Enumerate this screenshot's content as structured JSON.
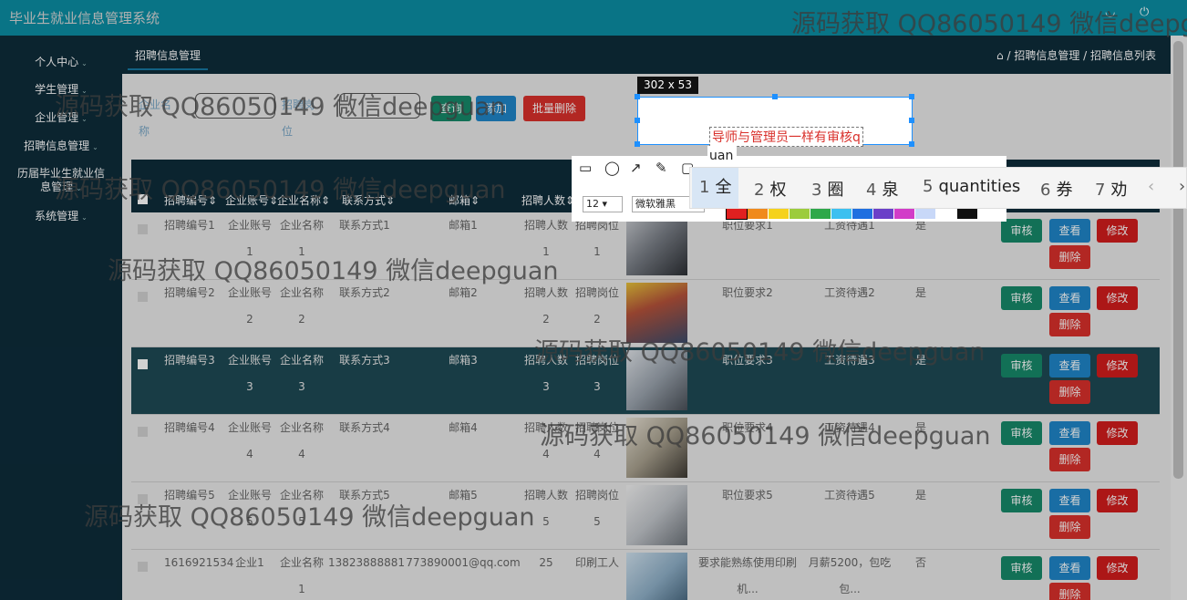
{
  "app_title": "毕业生就业信息管理系统",
  "sidebar": {
    "items": [
      {
        "label": "个人中心"
      },
      {
        "label": "学生管理"
      },
      {
        "label": "企业管理"
      },
      {
        "label": "招聘信息管理"
      },
      {
        "label": "历届毕业生就业信\n息管理"
      },
      {
        "label": "系统管理"
      }
    ]
  },
  "tab": "招聘信息管理",
  "breadcrumb": "/ 招聘信息管理 / 招聘信息列表",
  "search": {
    "company_label": "企业名\n称",
    "position_label": "招聘岗\n位",
    "query_button": "查询",
    "add_button": "添加",
    "batch_delete_button": "批量删除"
  },
  "table": {
    "headers": [
      "招聘编号",
      "企业账号",
      "企业名称",
      "联系方式",
      "邮箱",
      "招聘人数"
    ],
    "rows": [
      {
        "id": "招聘编号1",
        "account": "企业账号\n1",
        "company": "企业名称\n1",
        "contact": "联系方式1",
        "email": "邮箱1",
        "count": "招聘人数\n1",
        "position": "招聘岗位\n1",
        "req": "职位要求1",
        "pay": "工资待遇1",
        "flag": "是"
      },
      {
        "id": "招聘编号2",
        "account": "企业账号\n2",
        "company": "企业名称\n2",
        "contact": "联系方式2",
        "email": "邮箱2",
        "count": "招聘人数\n2",
        "position": "招聘岗位\n2",
        "req": "职位要求2",
        "pay": "工资待遇2",
        "flag": "是"
      },
      {
        "id": "招聘编号3",
        "account": "企业账号\n3",
        "company": "企业名称\n3",
        "contact": "联系方式3",
        "email": "邮箱3",
        "count": "招聘人数\n3",
        "position": "招聘岗位\n3",
        "req": "职位要求3",
        "pay": "工资待遇3",
        "flag": "是"
      },
      {
        "id": "招聘编号4",
        "account": "企业账号\n4",
        "company": "企业名称\n4",
        "contact": "联系方式4",
        "email": "邮箱4",
        "count": "招聘人数\n4",
        "position": "招聘岗位\n4",
        "req": "职位要求4",
        "pay": "工资待遇4",
        "flag": "是"
      },
      {
        "id": "招聘编号5",
        "account": "企业账号\n5",
        "company": "企业名称\n5",
        "contact": "联系方式5",
        "email": "邮箱5",
        "count": "招聘人数\n5",
        "position": "招聘岗位\n5",
        "req": "职位要求5",
        "pay": "工资待遇5",
        "flag": "是"
      },
      {
        "id": "1616921534",
        "account": "企业1",
        "company": "企业名称\n1",
        "contact": "13823888881",
        "email": "773890001@qq.com",
        "count": "25",
        "position": "印刷工人",
        "req": "要求能熟练使用印刷\n机...",
        "pay": "月薪5200，包吃\n包...",
        "flag": "否"
      }
    ],
    "actions": {
      "review": "审核",
      "view": "查看",
      "edit": "修改",
      "delete": "删除"
    }
  },
  "capture_tool": {
    "size_label": "302 x 53",
    "annotation_text": "导师与管理员一样有审核q",
    "font_size": "12",
    "font_face": "微软雅黑",
    "swatches": [
      "#e02020",
      "#f08a1c",
      "#f5d21c",
      "#9ccc3c",
      "#2ea84a",
      "#3cc0f0",
      "#1f6fe0",
      "#6a3fc8",
      "#d23cc8",
      "#c8d8f8",
      "#ffffff",
      "#111111"
    ]
  },
  "ime": {
    "composition": "uan",
    "candidates": [
      "全",
      "权",
      "圈",
      "泉",
      "quantities",
      "券",
      "劝"
    ]
  },
  "watermark": "源码获取 QQ86050149 微信deepguan"
}
